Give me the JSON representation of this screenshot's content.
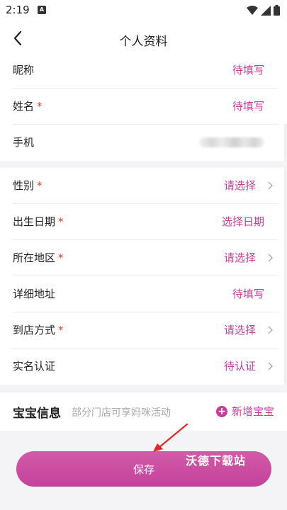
{
  "status_bar": {
    "time": "2:19",
    "notif_letter": "A"
  },
  "nav": {
    "title": "个人资料"
  },
  "rows": [
    {
      "label": "昵称",
      "required": false,
      "value": "待填写",
      "arrow": false
    },
    {
      "label": "姓名",
      "required": true,
      "value": "待填写",
      "arrow": false
    },
    {
      "label": "手机",
      "required": false,
      "value": "",
      "arrow": false
    },
    {
      "label": "性别",
      "required": true,
      "value": "请选择",
      "arrow": true
    },
    {
      "label": "出生日期",
      "required": true,
      "value": "选择日期",
      "arrow": false
    },
    {
      "label": "所在地区",
      "required": true,
      "value": "请选择",
      "arrow": true
    },
    {
      "label": "详细地址",
      "required": false,
      "value": "待填写",
      "arrow": false
    },
    {
      "label": "到店方式",
      "required": true,
      "value": "请选择",
      "arrow": true
    },
    {
      "label": "实名认证",
      "required": false,
      "value": "待认证",
      "arrow": true
    }
  ],
  "required_mark": "*",
  "baby": {
    "title": "宝宝信息",
    "hint": "部分门店可享妈咪活动",
    "add_icon": "+",
    "add_label": "新增宝宝"
  },
  "save_label": "保存",
  "watermark": "沃德下载站",
  "colors": {
    "accent": "#c63e9a",
    "required": "#e0403c",
    "background_gray": "#f4f4f6"
  },
  "icons": {
    "back": "chevron-left-icon",
    "arrow": "chevron-right-icon",
    "add": "plus-circle-icon"
  }
}
